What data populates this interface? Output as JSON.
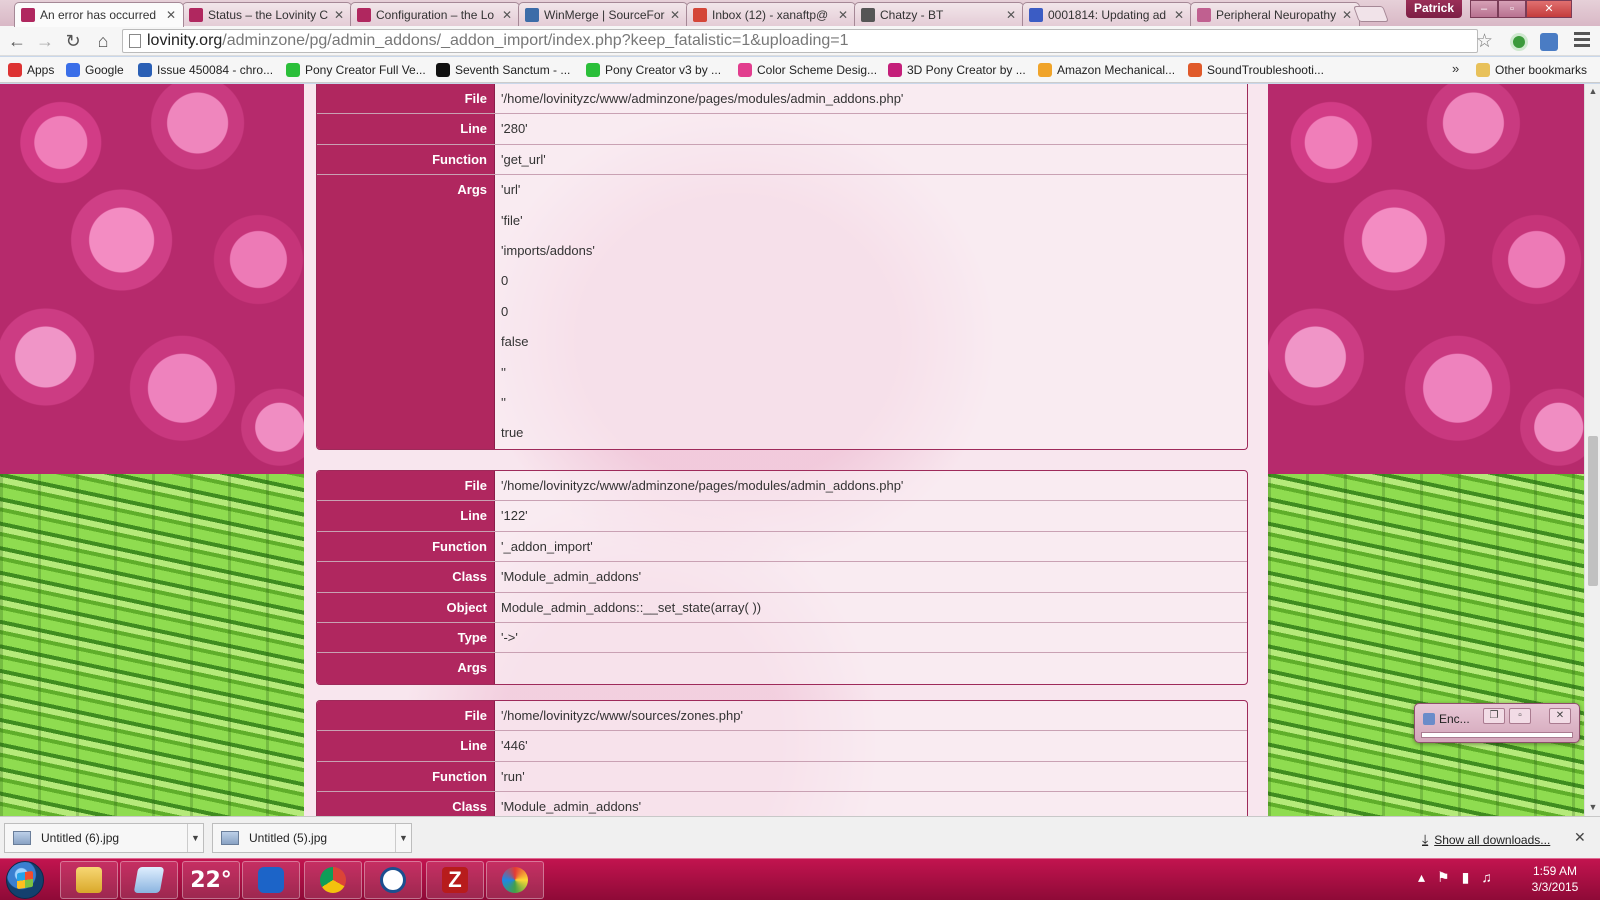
{
  "tabs": [
    {
      "title": "An error has occurred",
      "favicon": "pony-logo-icon",
      "color": "#b0275f",
      "active": true
    },
    {
      "title": "Status – the Lovinity C",
      "favicon": "pony-logo-icon",
      "color": "#b0275f"
    },
    {
      "title": "Configuration – the Lo",
      "favicon": "pony-logo-icon",
      "color": "#b0275f"
    },
    {
      "title": "WinMerge | SourceFor",
      "favicon": "sourceforge-icon",
      "color": "#3c6ca8"
    },
    {
      "title": "Inbox (12) - xanaftp@",
      "favicon": "gmail-icon",
      "color": "#d44638"
    },
    {
      "title": "Chatzy - BT",
      "favicon": "chatzy-icon",
      "color": "#555555"
    },
    {
      "title": "0001814: Updating ad",
      "favicon": "mantis-icon",
      "color": "#3b5cc4"
    },
    {
      "title": "Peripheral Neuropathy",
      "favicon": "medical-icon",
      "color": "#c06090"
    }
  ],
  "profile_name": "Patrick",
  "address": {
    "host": "lovinity.org",
    "path": "/adminzone/pg/admin_addons/_addon_import/index.php?keep_fatalistic=1&uploading=1"
  },
  "bookmarks": [
    {
      "label": "Apps",
      "icon": "apps-grid-icon",
      "color": "#d33"
    },
    {
      "label": "Google",
      "icon": "google-icon",
      "color": "#3a6ee8"
    },
    {
      "label": "Issue 450084 - chro...",
      "icon": "chromium-bug-icon",
      "color": "#2a5fb5"
    },
    {
      "label": "Pony Creator Full Ve...",
      "icon": "pony-creator-icon",
      "color": "#2bbf3a"
    },
    {
      "label": "Seventh Sanctum - ...",
      "icon": "yin-yang-icon",
      "color": "#111"
    },
    {
      "label": "Pony Creator v3 by ...",
      "icon": "pony-creator-icon",
      "color": "#2bbf3a"
    },
    {
      "label": "Color Scheme Desig...",
      "icon": "color-wheel-icon",
      "color": "#e23d8e"
    },
    {
      "label": "3D Pony Creator by ...",
      "icon": "3d-pony-icon",
      "color": "#c41f7a"
    },
    {
      "label": "Amazon Mechanical...",
      "icon": "amazon-box-icon",
      "color": "#f0a42a"
    },
    {
      "label": "SoundTroubleshooti...",
      "icon": "sound-icon",
      "color": "#e05a2a"
    }
  ],
  "other_bookmarks": "Other bookmarks",
  "trace_blocks": [
    {
      "rows": [
        {
          "key": "File",
          "value": "'/home/lovinityzc/www/adminzone/pages/modules/admin_addons.php'"
        },
        {
          "key": "Line",
          "value": "'280'"
        },
        {
          "key": "Function",
          "value": "'get_url'"
        }
      ],
      "args_label": "Args",
      "args": [
        "'url'",
        "'file'",
        "'imports/addons'",
        "0",
        "0",
        "false",
        "''",
        "''",
        "true"
      ]
    },
    {
      "rows": [
        {
          "key": "File",
          "value": "'/home/lovinityzc/www/adminzone/pages/modules/admin_addons.php'"
        },
        {
          "key": "Line",
          "value": "'122'"
        },
        {
          "key": "Function",
          "value": "'_addon_import'"
        },
        {
          "key": "Class",
          "value": "'Module_admin_addons'"
        },
        {
          "key": "Object",
          "value": "Module_admin_addons::__set_state(array( ))"
        },
        {
          "key": "Type",
          "value": "'->'"
        },
        {
          "key": "Args",
          "value": ""
        }
      ]
    },
    {
      "rows": [
        {
          "key": "File",
          "value": "'/home/lovinityzc/www/sources/zones.php'"
        },
        {
          "key": "Line",
          "value": "'446'"
        },
        {
          "key": "Function",
          "value": "'run'"
        },
        {
          "key": "Class",
          "value": "'Module_admin_addons'"
        }
      ]
    }
  ],
  "mini_window": {
    "title": "Enc..."
  },
  "downloads": [
    {
      "name": "Untitled (6).jpg"
    },
    {
      "name": "Untitled (5).jpg"
    }
  ],
  "show_all_downloads": "Show all downloads...",
  "taskbar": {
    "temperature": "22°",
    "apps": [
      "file-explorer-icon",
      "notepad-icon",
      "weather-gadget-icon",
      "teamviewer-icon",
      "chrome-icon",
      "chat-bubble-icon",
      "filezilla-icon",
      "paint-icon"
    ]
  },
  "clock": {
    "time": "1:59 AM",
    "date": "3/3/2015"
  }
}
